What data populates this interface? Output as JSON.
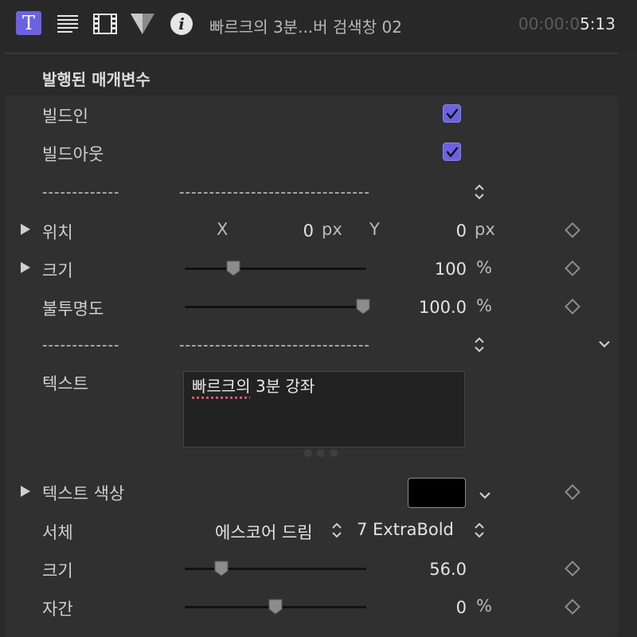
{
  "toolbar": {
    "title_icon": "T",
    "clip_title": "빠르크의 3분...버 검색창 02",
    "timecode_dim": "00:00:0",
    "timecode_bright": "5:13"
  },
  "section": {
    "title": "발행된 매개변수"
  },
  "build_in": {
    "label": "빌드인",
    "checked": true
  },
  "build_out": {
    "label": "빌드아웃",
    "checked": true
  },
  "separator1": {
    "left": "-------------",
    "right": "--------------------------------"
  },
  "position": {
    "label": "위치",
    "x_label": "X",
    "x_value": "0",
    "x_unit": "px",
    "y_label": "Y",
    "y_value": "0",
    "y_unit": "px"
  },
  "size": {
    "label": "크기",
    "value": "100",
    "unit": "%",
    "slider_fraction": 0.26
  },
  "opacity": {
    "label": "불투명도",
    "value": "100.0",
    "unit": "%",
    "slider_fraction": 1.0
  },
  "separator2": {
    "left": "-------------",
    "right": "--------------------------------"
  },
  "text": {
    "label": "텍스트",
    "content_misspelled": "빠르크의",
    "content_rest": " 3분 강좌"
  },
  "text_color": {
    "label": "텍스트 색상",
    "color": "#000000"
  },
  "font": {
    "label": "서체",
    "family": "에스코어 드림",
    "weight": "7 ExtraBold"
  },
  "font_size": {
    "label": "크기",
    "value": "56.0",
    "slider_fraction": 0.19
  },
  "tracking": {
    "label": "자간",
    "value": "0",
    "unit": "%",
    "slider_fraction": 0.5
  },
  "colors": {
    "accent": "#6a62e0",
    "background": "#2a2a2a",
    "panel": "#303030"
  }
}
